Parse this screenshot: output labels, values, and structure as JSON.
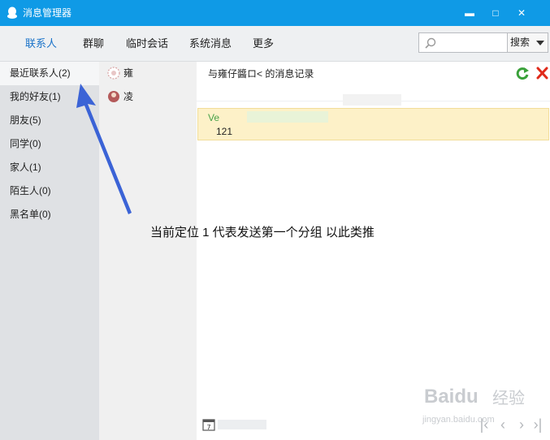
{
  "window": {
    "title": "消息管理器",
    "controls": {
      "minimize": "▬",
      "maximize": "□",
      "close": "✕"
    }
  },
  "tabs": [
    {
      "label": "联系人",
      "active": true
    },
    {
      "label": "群聊"
    },
    {
      "label": "临时会话"
    },
    {
      "label": "系统消息"
    },
    {
      "label": "更多"
    }
  ],
  "search": {
    "placeholder": "",
    "value": "",
    "button": "搜索"
  },
  "groups": [
    {
      "label": "最近联系人(2)",
      "selected": true
    },
    {
      "label": "我的好友(1)"
    },
    {
      "label": "朋友(5)"
    },
    {
      "label": "同学(0)"
    },
    {
      "label": "家人(1)"
    },
    {
      "label": "陌生人(0)"
    },
    {
      "label": "黑名单(0)"
    }
  ],
  "contacts": [
    {
      "name": "雍"
    },
    {
      "name": "凌"
    }
  ],
  "message_header": {
    "text": "与雍仔醬ロ<                       的消息记录"
  },
  "messages": [
    {
      "sender": "Ve",
      "body": "121"
    }
  ],
  "annotation": {
    "text": "当前定位 1 代表发送第一个分组 以此类推"
  },
  "watermark": {
    "brand": "Baidu",
    "brand_cn": "经验",
    "site": "jingyan.baidu.com"
  },
  "colors": {
    "titlebar": "#0f9ae6",
    "active_tab": "#1a73c9",
    "arrow": "#3b63d6",
    "highlight": "#fdf1c8",
    "refresh": "#3aa13a",
    "delete": "#e02a1a"
  }
}
